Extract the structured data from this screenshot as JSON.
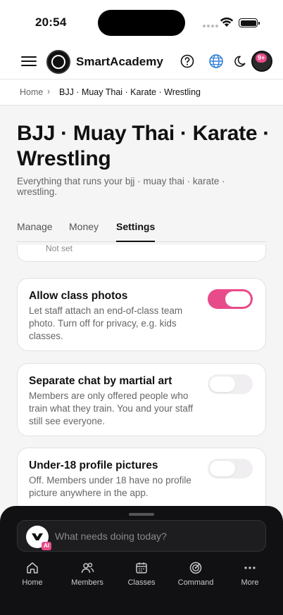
{
  "status_bar": {
    "time": "20:54"
  },
  "header": {
    "brand": "SmartAcademy",
    "avatar_badge": "9+"
  },
  "breadcrumb": {
    "home": "Home",
    "separator": "›",
    "current": "BJJ · Muay Thai · Karate · Wrestling"
  },
  "page": {
    "title": "BJJ · Muay Thai · Karate · Wrestling",
    "subtitle": "Everything that runs your bjj · muay thai · karate · wrestling."
  },
  "tabs": [
    {
      "label": "Manage",
      "active": false
    },
    {
      "label": "Money",
      "active": false
    },
    {
      "label": "Settings",
      "active": true
    }
  ],
  "previous_card": {
    "value": "Not set"
  },
  "settings": [
    {
      "title": "Allow class photos",
      "description": "Let staff attach an end-of-class team photo. Turn off for privacy, e.g. kids classes.",
      "enabled": true
    },
    {
      "title": "Separate chat by martial art",
      "description": "Members are only offered people who train what they train. You and your staff still see everyone.",
      "enabled": false
    },
    {
      "title": "Under-18 profile pictures",
      "description": "Off. Members under 18 have no profile picture anywhere in the app.",
      "enabled": false
    }
  ],
  "assistant": {
    "placeholder": "What needs doing today?",
    "ai_tag": "AI"
  },
  "bottom_nav": [
    {
      "label": "Home",
      "icon": "home-icon"
    },
    {
      "label": "Members",
      "icon": "members-icon"
    },
    {
      "label": "Classes",
      "icon": "calendar-icon"
    },
    {
      "label": "Command",
      "icon": "target-icon"
    },
    {
      "label": "More",
      "icon": "more-icon"
    }
  ],
  "colors": {
    "accent": "#e84b8a",
    "sheet": "#111113"
  }
}
